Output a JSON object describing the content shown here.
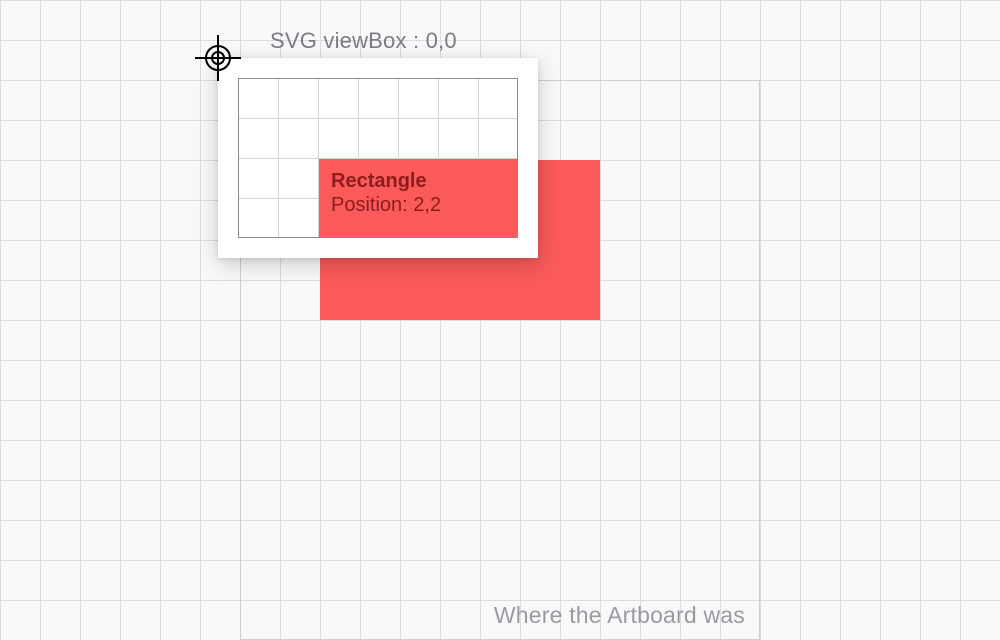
{
  "viewbox_label": "SVG viewBox : 0,0",
  "rectangle": {
    "title": "Rectangle",
    "position_label": "Position: 2,2"
  },
  "artboard_label": "Where the Artboard was",
  "colors": {
    "red": "#fa5a5a",
    "grid_line": "#dcdcdf",
    "inner_grid_line": "#d3d3d8",
    "popover_border": "#8a8a94",
    "text_muted": "#7c7c86",
    "text_dark_red": "#8e1c1c"
  }
}
